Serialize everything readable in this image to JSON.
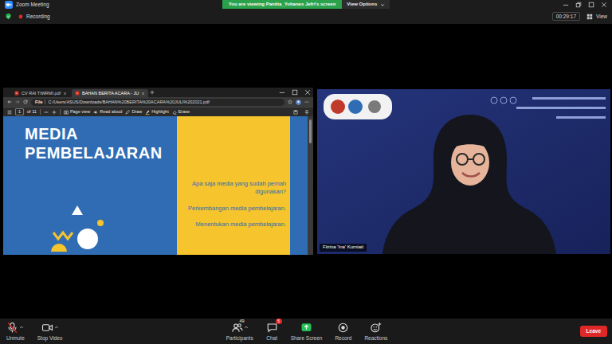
{
  "window": {
    "title": "Zoom Meeting"
  },
  "banner": {
    "text": "You are viewing Panitia_Yohanes Jefri's screen",
    "options": "View Options"
  },
  "status": {
    "recording": "Recording",
    "timer": "00:29:17",
    "view": "View"
  },
  "shared_screen": {
    "tabs": [
      {
        "label": "CV RAI TIWRMI.pdf",
        "selected": false
      },
      {
        "label": "BAHAN BERITA ACARA - JU",
        "selected": true
      }
    ],
    "address": {
      "scheme": "File",
      "url": "C:/Users/ASUS/Downloads/BAHAN%20BERITA%20ACARA%20JULI%202021.pdf"
    },
    "pdf_toolbar": {
      "page": "1",
      "total": "of 11",
      "tools": [
        {
          "kind": "pageview",
          "label": "Page view"
        },
        {
          "kind": "readaloud",
          "label": "Read aloud"
        },
        {
          "kind": "draw",
          "label": "Draw"
        },
        {
          "kind": "highlight",
          "label": "Highlight"
        },
        {
          "kind": "erase",
          "label": "Erase"
        }
      ]
    },
    "slide": {
      "title": "MEDIA PEMBELAJARAN",
      "points": [
        "Apa saja media yang sudah pernah digunakan?",
        "Perkembangan media pembelajaran.",
        "Menentukan media pembelajaran."
      ]
    }
  },
  "video": {
    "name": "Fitrina 'Ina' Kurniati"
  },
  "toolbar": {
    "audio": {
      "label": "Unmute",
      "muted": true,
      "menu": true
    },
    "camera": {
      "label": "Stop Video",
      "on": true,
      "menu": true
    },
    "items": [
      {
        "kind": "participants",
        "label": "Participants",
        "count": "49",
        "menu": true
      },
      {
        "kind": "chat",
        "label": "Chat",
        "badge": "5",
        "menu": false
      },
      {
        "kind": "share",
        "label": "Share Screen",
        "menu": false
      },
      {
        "kind": "record",
        "label": "Record",
        "menu": false
      },
      {
        "kind": "reactions",
        "label": "Reactions",
        "menu": false
      }
    ],
    "leave": "Leave"
  }
}
